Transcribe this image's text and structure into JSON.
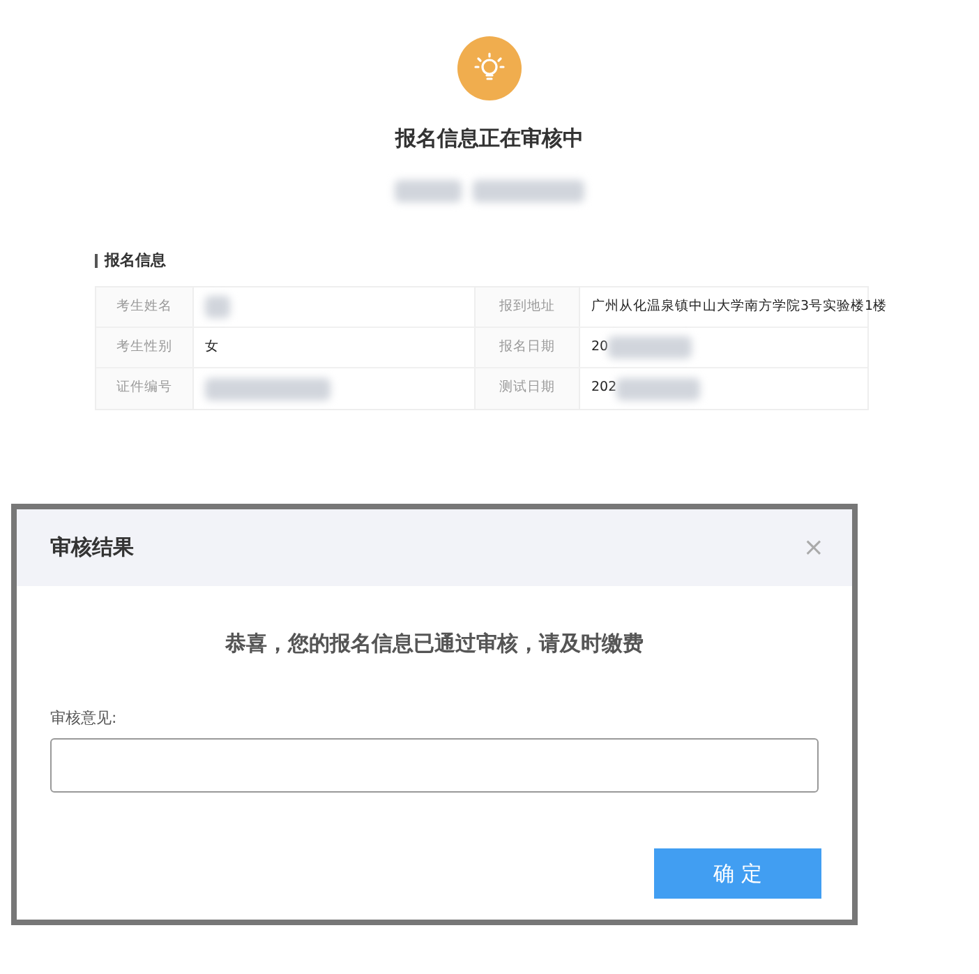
{
  "status": {
    "title": "报名信息正在审核中"
  },
  "section": {
    "title": "报名信息"
  },
  "info_rows": [
    {
      "label_1": "考生姓名",
      "value_1": "",
      "redacted_1": true,
      "label_2": "报到地址",
      "value_2": "广州从化温泉镇中山大学南方学院3号实验楼1楼",
      "redacted_2": false
    },
    {
      "label_1": "考生性别",
      "value_1": "女",
      "redacted_1": false,
      "label_2": "报名日期",
      "value_2": "20",
      "redacted_2": true
    },
    {
      "label_1": "证件编号",
      "value_1": "",
      "redacted_1": true,
      "label_2": "测试日期",
      "value_2": "202",
      "redacted_2": true
    }
  ],
  "dialog": {
    "title": "审核结果",
    "close": "×",
    "message": "恭喜，您的报名信息已通过审核，请及时缴费",
    "field_label": "审核意见:",
    "confirm": "确 定"
  }
}
